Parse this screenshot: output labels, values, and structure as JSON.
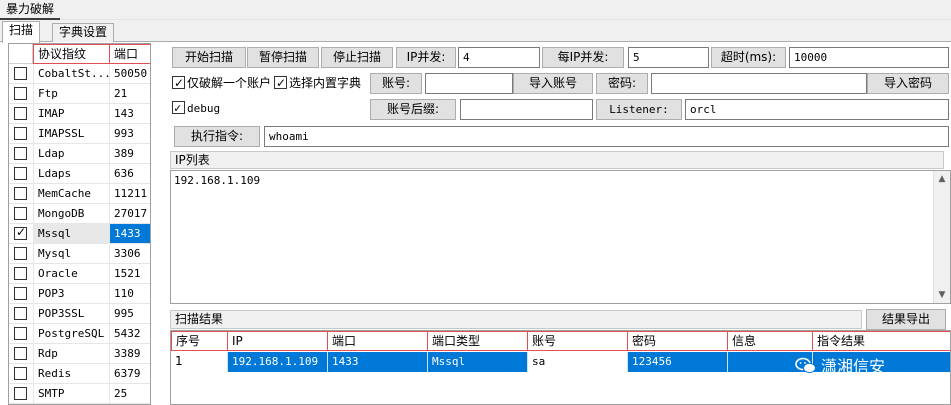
{
  "menu": {
    "title": "暴力破解"
  },
  "tabs": [
    {
      "label": "扫描"
    },
    {
      "label": "字典设置"
    }
  ],
  "protocols": {
    "headers": {
      "name": "协议指纹",
      "port": "端口"
    },
    "rows": [
      {
        "name": "CobaltSt...",
        "port": "50050",
        "checked": false
      },
      {
        "name": "Ftp",
        "port": "21",
        "checked": false
      },
      {
        "name": "IMAP",
        "port": "143",
        "checked": false
      },
      {
        "name": "IMAPSSL",
        "port": "993",
        "checked": false
      },
      {
        "name": "Ldap",
        "port": "389",
        "checked": false
      },
      {
        "name": "Ldaps",
        "port": "636",
        "checked": false
      },
      {
        "name": "MemCache",
        "port": "11211",
        "checked": false
      },
      {
        "name": "MongoDB",
        "port": "27017",
        "checked": false
      },
      {
        "name": "Mssql",
        "port": "1433",
        "checked": true
      },
      {
        "name": "Mysql",
        "port": "3306",
        "checked": false
      },
      {
        "name": "Oracle",
        "port": "1521",
        "checked": false
      },
      {
        "name": "POP3",
        "port": "110",
        "checked": false
      },
      {
        "name": "POP3SSL",
        "port": "995",
        "checked": false
      },
      {
        "name": "PostgreSQL",
        "port": "5432",
        "checked": false
      },
      {
        "name": "Rdp",
        "port": "3389",
        "checked": false
      },
      {
        "name": "Redis",
        "port": "6379",
        "checked": false
      },
      {
        "name": "SMTP",
        "port": "25",
        "checked": false
      }
    ]
  },
  "toolbar": {
    "start": "开始扫描",
    "pause": "暂停扫描",
    "stop": "停止扫描",
    "ip_concurrency_label": "IP并发:",
    "ip_concurrency_value": "4",
    "per_ip_concurrency_label": "每IP并发:",
    "per_ip_concurrency_value": "5",
    "timeout_label": "超时(ms):",
    "timeout_value": "10000"
  },
  "options": {
    "crack_one_account": "仅破解一个账户",
    "use_builtin_dict": "选择内置字典",
    "account_label": "账号:",
    "import_account": "导入账号",
    "password_label": "密码:",
    "import_password": "导入密码",
    "debug": "debug",
    "account_suffix_label": "账号后缀:",
    "listener_label": "Listener:",
    "listener_value": "orcl",
    "exec_cmd_label": "执行指令:",
    "exec_cmd_value": "whoami"
  },
  "ip_list": {
    "title": "IP列表",
    "content": "192.168.1.109"
  },
  "results": {
    "title": "扫描结果",
    "export": "结果导出",
    "headers": [
      "序号",
      "IP",
      "端口",
      "端口类型",
      "账号",
      "密码",
      "信息",
      "指令结果"
    ],
    "rows": [
      [
        "1",
        "192.168.1.109",
        "1433",
        "Mssql",
        "sa",
        "123456",
        "",
        ""
      ]
    ]
  },
  "watermark": "潇湘信安"
}
